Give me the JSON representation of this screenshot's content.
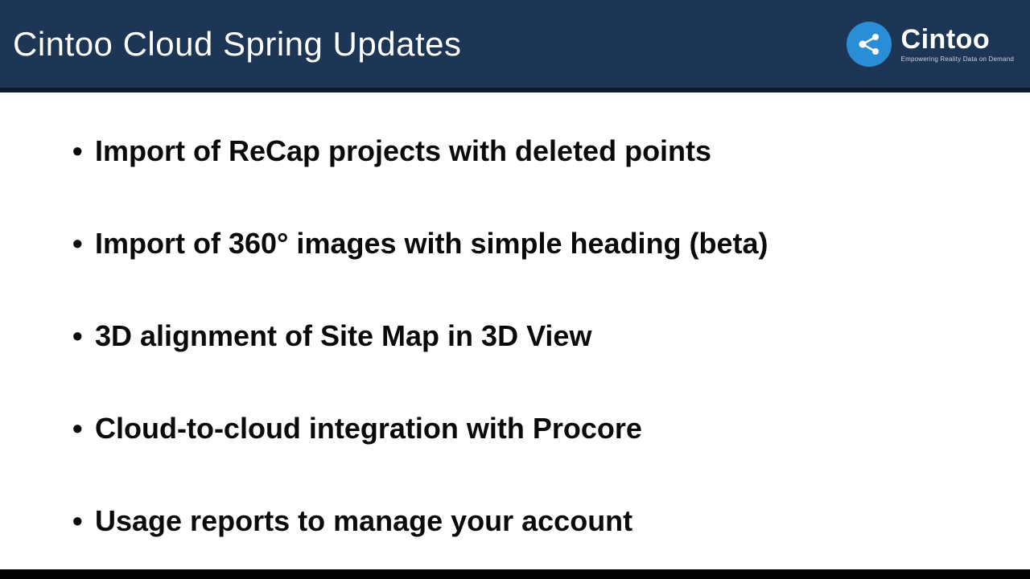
{
  "header": {
    "title": "Cintoo Cloud Spring Updates",
    "brand_name": "Cintoo",
    "brand_tagline": "Empowering Reality Data on Demand"
  },
  "bullets": [
    "Import of ReCap projects with deleted points",
    "Import of 360° images with simple heading (beta)",
    "3D alignment of Site Map in 3D View",
    "Cloud-to-cloud integration with Procore",
    "Usage reports to manage your account"
  ]
}
